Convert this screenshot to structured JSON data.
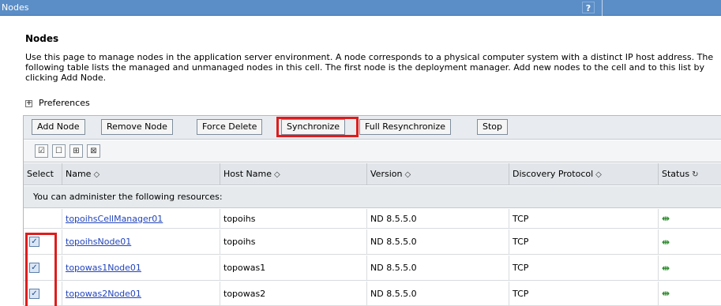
{
  "window": {
    "title": "Nodes",
    "help": "?"
  },
  "page": {
    "heading": "Nodes",
    "description": "Use this page to manage nodes in the application server environment. A node corresponds to a physical computer system with a distinct IP host address. The following table lists the managed and unmanaged nodes in this cell. The first node is the deployment manager. Add new nodes to the cell and to this list by clicking Add Node.",
    "preferences_label": "Preferences",
    "preferences_icon": "plus-box-icon"
  },
  "toolbar": {
    "add_node": "Add Node",
    "remove_node": "Remove Node",
    "force_delete": "Force Delete",
    "synchronize": "Synchronize",
    "full_resync": "Full Resynchronize",
    "stop": "Stop"
  },
  "icon_toolbar": {
    "icons": [
      "select-all-icon",
      "deselect-all-icon",
      "show-filter-icon",
      "clear-filter-icon"
    ]
  },
  "table": {
    "columns": {
      "select": "Select",
      "name": "Name",
      "host": "Host Name",
      "version": "Version",
      "protocol": "Discovery Protocol",
      "status": "Status"
    },
    "group_label": "You can administer the following resources:",
    "rows": [
      {
        "checkbox": false,
        "checked": false,
        "name": "topoihsCellManager01",
        "host": "topoihs",
        "version": "ND 8.5.5.0",
        "protocol": "TCP",
        "status_icon": "status-unknown-icon"
      },
      {
        "checkbox": true,
        "checked": true,
        "name": "topoihsNode01",
        "host": "topoihs",
        "version": "ND 8.5.5.0",
        "protocol": "TCP",
        "status_icon": "status-unknown-icon"
      },
      {
        "checkbox": true,
        "checked": true,
        "name": "topowas1Node01",
        "host": "topowas1",
        "version": "ND 8.5.5.0",
        "protocol": "TCP",
        "status_icon": "status-unknown-icon"
      },
      {
        "checkbox": true,
        "checked": true,
        "name": "topowas2Node01",
        "host": "topowas2",
        "version": "ND 8.5.5.0",
        "protocol": "TCP",
        "status_icon": "status-unknown-icon"
      }
    ]
  },
  "colors": {
    "titlebar": "#5b8ec7",
    "highlight": "#dd1d1d",
    "link": "#2244bb"
  }
}
